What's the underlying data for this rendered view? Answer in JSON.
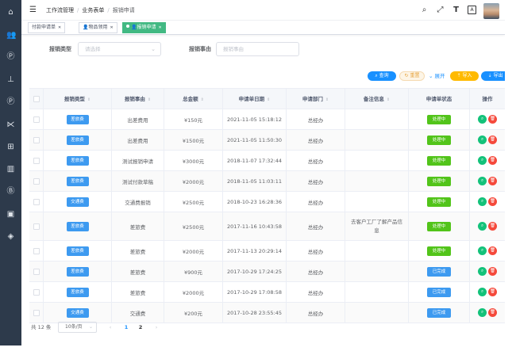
{
  "header": {
    "breadcrumb": [
      "工作流管理",
      "业务表单",
      "报销申请"
    ]
  },
  "tags": [
    {
      "label": "付款申请单",
      "active": false
    },
    {
      "label": "物品领用",
      "active": false
    },
    {
      "label": "报销申请",
      "active": true
    }
  ],
  "filters": {
    "type_label": "报销类型",
    "type_placeholder": "请选择",
    "reason_label": "报销事由",
    "reason_placeholder": "报销事由"
  },
  "actions": {
    "query": "查询",
    "reset": "重置",
    "expand": "展开",
    "import": "导入",
    "export": "导出"
  },
  "table": {
    "columns": [
      "报销类型",
      "报销事由",
      "总金额",
      "申请单日期",
      "申请部门",
      "备注信息",
      "申请单状态",
      "操作"
    ],
    "rows": [
      {
        "type": "差旅费",
        "reason": "出差费用",
        "amount": "¥150元",
        "date": "2021-11-05 15:18:12",
        "dept": "总经办",
        "note": "",
        "status": "处理中"
      },
      {
        "type": "差旅费",
        "reason": "出差费用",
        "amount": "¥1500元",
        "date": "2021-11-05 11:50:30",
        "dept": "总经办",
        "note": "",
        "status": "处理中"
      },
      {
        "type": "差旅费",
        "reason": "测试报销申请",
        "amount": "¥3000元",
        "date": "2018-11-07 17:32:44",
        "dept": "总经办",
        "note": "",
        "status": "处理中"
      },
      {
        "type": "差旅费",
        "reason": "测试付款草稿",
        "amount": "¥2000元",
        "date": "2018-11-05 11:03:11",
        "dept": "总经办",
        "note": "",
        "status": "处理中"
      },
      {
        "type": "交通费",
        "reason": "交通费报销",
        "amount": "¥2500元",
        "date": "2018-10-23 16:28:36",
        "dept": "总经办",
        "note": "",
        "status": "处理中"
      },
      {
        "type": "差旅费",
        "reason": "差旅费",
        "amount": "¥2500元",
        "date": "2017-11-16 10:43:58",
        "dept": "总经办",
        "note": "去客户工厂了解产品信息",
        "status": "处理中"
      },
      {
        "type": "差旅费",
        "reason": "差旅费",
        "amount": "¥2000元",
        "date": "2017-11-13 20:29:14",
        "dept": "总经办",
        "note": "",
        "status": "处理中"
      },
      {
        "type": "差旅费",
        "reason": "差旅费",
        "amount": "¥900元",
        "date": "2017-10-29 17:24:25",
        "dept": "总经办",
        "note": "",
        "status": "已完成"
      },
      {
        "type": "差旅费",
        "reason": "差旅费",
        "amount": "¥2000元",
        "date": "2017-10-29 17:08:58",
        "dept": "总经办",
        "note": "",
        "status": "已完成"
      },
      {
        "type": "交通费",
        "reason": "交通费",
        "amount": "¥200元",
        "date": "2017-10-28 23:55:45",
        "dept": "总经办",
        "note": "",
        "status": "已完成"
      }
    ]
  },
  "pagination": {
    "total": "共 12 条",
    "page_size": "10条/页",
    "pages": [
      "1",
      "2"
    ],
    "current": "1"
  },
  "colors": {
    "sidebar": "#2d3a4b",
    "primary": "#1890ff",
    "success": "#52c41a",
    "tag_active": "#42b983",
    "danger": "#f5493b",
    "warning": "#ffba00"
  },
  "icons": {
    "sidebar": [
      "home-icon",
      "users-icon",
      "p-icon",
      "org-icon",
      "p-icon",
      "share-icon",
      "tree-icon",
      "building-icon",
      "b-icon",
      "id-card-icon",
      "layers-icon"
    ],
    "header": [
      "search-icon",
      "fullscreen-icon",
      "font-size-icon",
      "translate-icon"
    ]
  }
}
